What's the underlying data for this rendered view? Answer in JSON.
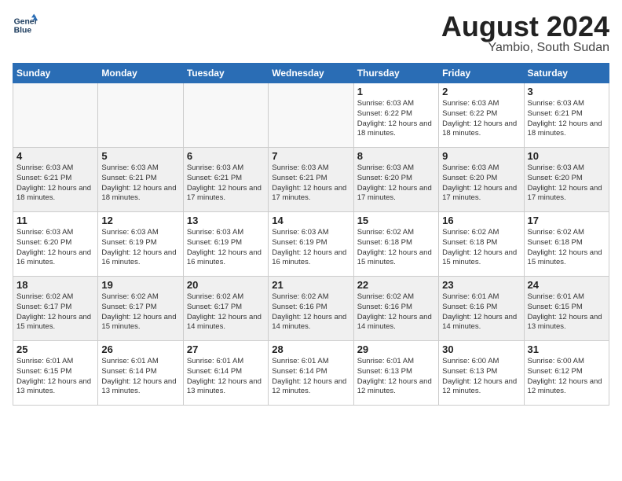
{
  "header": {
    "logo_line1": "General",
    "logo_line2": "Blue",
    "month_title": "August 2024",
    "subtitle": "Yambio, South Sudan"
  },
  "days_of_week": [
    "Sunday",
    "Monday",
    "Tuesday",
    "Wednesday",
    "Thursday",
    "Friday",
    "Saturday"
  ],
  "weeks": [
    {
      "alt": false,
      "days": [
        {
          "num": "",
          "info": ""
        },
        {
          "num": "",
          "info": ""
        },
        {
          "num": "",
          "info": ""
        },
        {
          "num": "",
          "info": ""
        },
        {
          "num": "1",
          "info": "Sunrise: 6:03 AM\nSunset: 6:22 PM\nDaylight: 12 hours\nand 18 minutes."
        },
        {
          "num": "2",
          "info": "Sunrise: 6:03 AM\nSunset: 6:22 PM\nDaylight: 12 hours\nand 18 minutes."
        },
        {
          "num": "3",
          "info": "Sunrise: 6:03 AM\nSunset: 6:21 PM\nDaylight: 12 hours\nand 18 minutes."
        }
      ]
    },
    {
      "alt": true,
      "days": [
        {
          "num": "4",
          "info": "Sunrise: 6:03 AM\nSunset: 6:21 PM\nDaylight: 12 hours\nand 18 minutes."
        },
        {
          "num": "5",
          "info": "Sunrise: 6:03 AM\nSunset: 6:21 PM\nDaylight: 12 hours\nand 18 minutes."
        },
        {
          "num": "6",
          "info": "Sunrise: 6:03 AM\nSunset: 6:21 PM\nDaylight: 12 hours\nand 17 minutes."
        },
        {
          "num": "7",
          "info": "Sunrise: 6:03 AM\nSunset: 6:21 PM\nDaylight: 12 hours\nand 17 minutes."
        },
        {
          "num": "8",
          "info": "Sunrise: 6:03 AM\nSunset: 6:20 PM\nDaylight: 12 hours\nand 17 minutes."
        },
        {
          "num": "9",
          "info": "Sunrise: 6:03 AM\nSunset: 6:20 PM\nDaylight: 12 hours\nand 17 minutes."
        },
        {
          "num": "10",
          "info": "Sunrise: 6:03 AM\nSunset: 6:20 PM\nDaylight: 12 hours\nand 17 minutes."
        }
      ]
    },
    {
      "alt": false,
      "days": [
        {
          "num": "11",
          "info": "Sunrise: 6:03 AM\nSunset: 6:20 PM\nDaylight: 12 hours\nand 16 minutes."
        },
        {
          "num": "12",
          "info": "Sunrise: 6:03 AM\nSunset: 6:19 PM\nDaylight: 12 hours\nand 16 minutes."
        },
        {
          "num": "13",
          "info": "Sunrise: 6:03 AM\nSunset: 6:19 PM\nDaylight: 12 hours\nand 16 minutes."
        },
        {
          "num": "14",
          "info": "Sunrise: 6:03 AM\nSunset: 6:19 PM\nDaylight: 12 hours\nand 16 minutes."
        },
        {
          "num": "15",
          "info": "Sunrise: 6:02 AM\nSunset: 6:18 PM\nDaylight: 12 hours\nand 15 minutes."
        },
        {
          "num": "16",
          "info": "Sunrise: 6:02 AM\nSunset: 6:18 PM\nDaylight: 12 hours\nand 15 minutes."
        },
        {
          "num": "17",
          "info": "Sunrise: 6:02 AM\nSunset: 6:18 PM\nDaylight: 12 hours\nand 15 minutes."
        }
      ]
    },
    {
      "alt": true,
      "days": [
        {
          "num": "18",
          "info": "Sunrise: 6:02 AM\nSunset: 6:17 PM\nDaylight: 12 hours\nand 15 minutes."
        },
        {
          "num": "19",
          "info": "Sunrise: 6:02 AM\nSunset: 6:17 PM\nDaylight: 12 hours\nand 15 minutes."
        },
        {
          "num": "20",
          "info": "Sunrise: 6:02 AM\nSunset: 6:17 PM\nDaylight: 12 hours\nand 14 minutes."
        },
        {
          "num": "21",
          "info": "Sunrise: 6:02 AM\nSunset: 6:16 PM\nDaylight: 12 hours\nand 14 minutes."
        },
        {
          "num": "22",
          "info": "Sunrise: 6:02 AM\nSunset: 6:16 PM\nDaylight: 12 hours\nand 14 minutes."
        },
        {
          "num": "23",
          "info": "Sunrise: 6:01 AM\nSunset: 6:16 PM\nDaylight: 12 hours\nand 14 minutes."
        },
        {
          "num": "24",
          "info": "Sunrise: 6:01 AM\nSunset: 6:15 PM\nDaylight: 12 hours\nand 13 minutes."
        }
      ]
    },
    {
      "alt": false,
      "days": [
        {
          "num": "25",
          "info": "Sunrise: 6:01 AM\nSunset: 6:15 PM\nDaylight: 12 hours\nand 13 minutes."
        },
        {
          "num": "26",
          "info": "Sunrise: 6:01 AM\nSunset: 6:14 PM\nDaylight: 12 hours\nand 13 minutes."
        },
        {
          "num": "27",
          "info": "Sunrise: 6:01 AM\nSunset: 6:14 PM\nDaylight: 12 hours\nand 13 minutes."
        },
        {
          "num": "28",
          "info": "Sunrise: 6:01 AM\nSunset: 6:14 PM\nDaylight: 12 hours\nand 12 minutes."
        },
        {
          "num": "29",
          "info": "Sunrise: 6:01 AM\nSunset: 6:13 PM\nDaylight: 12 hours\nand 12 minutes."
        },
        {
          "num": "30",
          "info": "Sunrise: 6:00 AM\nSunset: 6:13 PM\nDaylight: 12 hours\nand 12 minutes."
        },
        {
          "num": "31",
          "info": "Sunrise: 6:00 AM\nSunset: 6:12 PM\nDaylight: 12 hours\nand 12 minutes."
        }
      ]
    }
  ]
}
